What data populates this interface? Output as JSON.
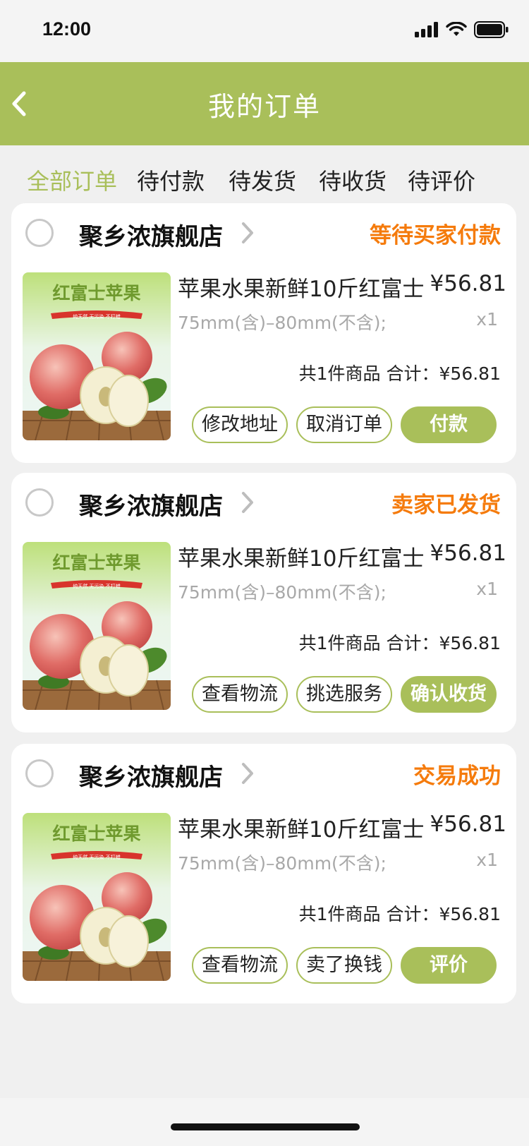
{
  "status_bar": {
    "time": "12:00"
  },
  "nav": {
    "title": "我的订单"
  },
  "tabs": [
    "全部订单",
    "待付款",
    "待发货",
    "待收货",
    "待评价"
  ],
  "colors": {
    "accent": "#a9bf5a",
    "status_orange": "#f57b0c",
    "muted": "#a8a8a8"
  },
  "product_image": {
    "title": "红富士苹果",
    "banner": "纯天然 无污染 不打蜡"
  },
  "orders": [
    {
      "store": "聚乡浓旗舰店",
      "status": "等待买家付款",
      "product_title": "苹果水果新鲜10斤红富士",
      "price": "¥56.81",
      "spec": "75mm(含)–80mm(不含);",
      "qty": "x1",
      "summary": "共1件商品 合计：¥56.81",
      "buttons": [
        "修改地址",
        "取消订单",
        "付款"
      ]
    },
    {
      "store": "聚乡浓旗舰店",
      "status": "卖家已发货",
      "product_title": "苹果水果新鲜10斤红富士",
      "price": "¥56.81",
      "spec": "75mm(含)–80mm(不含);",
      "qty": "x1",
      "summary": "共1件商品 合计：¥56.81",
      "buttons": [
        "查看物流",
        "挑选服务",
        "确认收货"
      ]
    },
    {
      "store": "聚乡浓旗舰店",
      "status": "交易成功",
      "product_title": "苹果水果新鲜10斤红富士",
      "price": "¥56.81",
      "spec": "75mm(含)–80mm(不含);",
      "qty": "x1",
      "summary": "共1件商品 合计：¥56.81",
      "buttons": [
        "查看物流",
        "卖了换钱",
        "评价"
      ]
    }
  ]
}
